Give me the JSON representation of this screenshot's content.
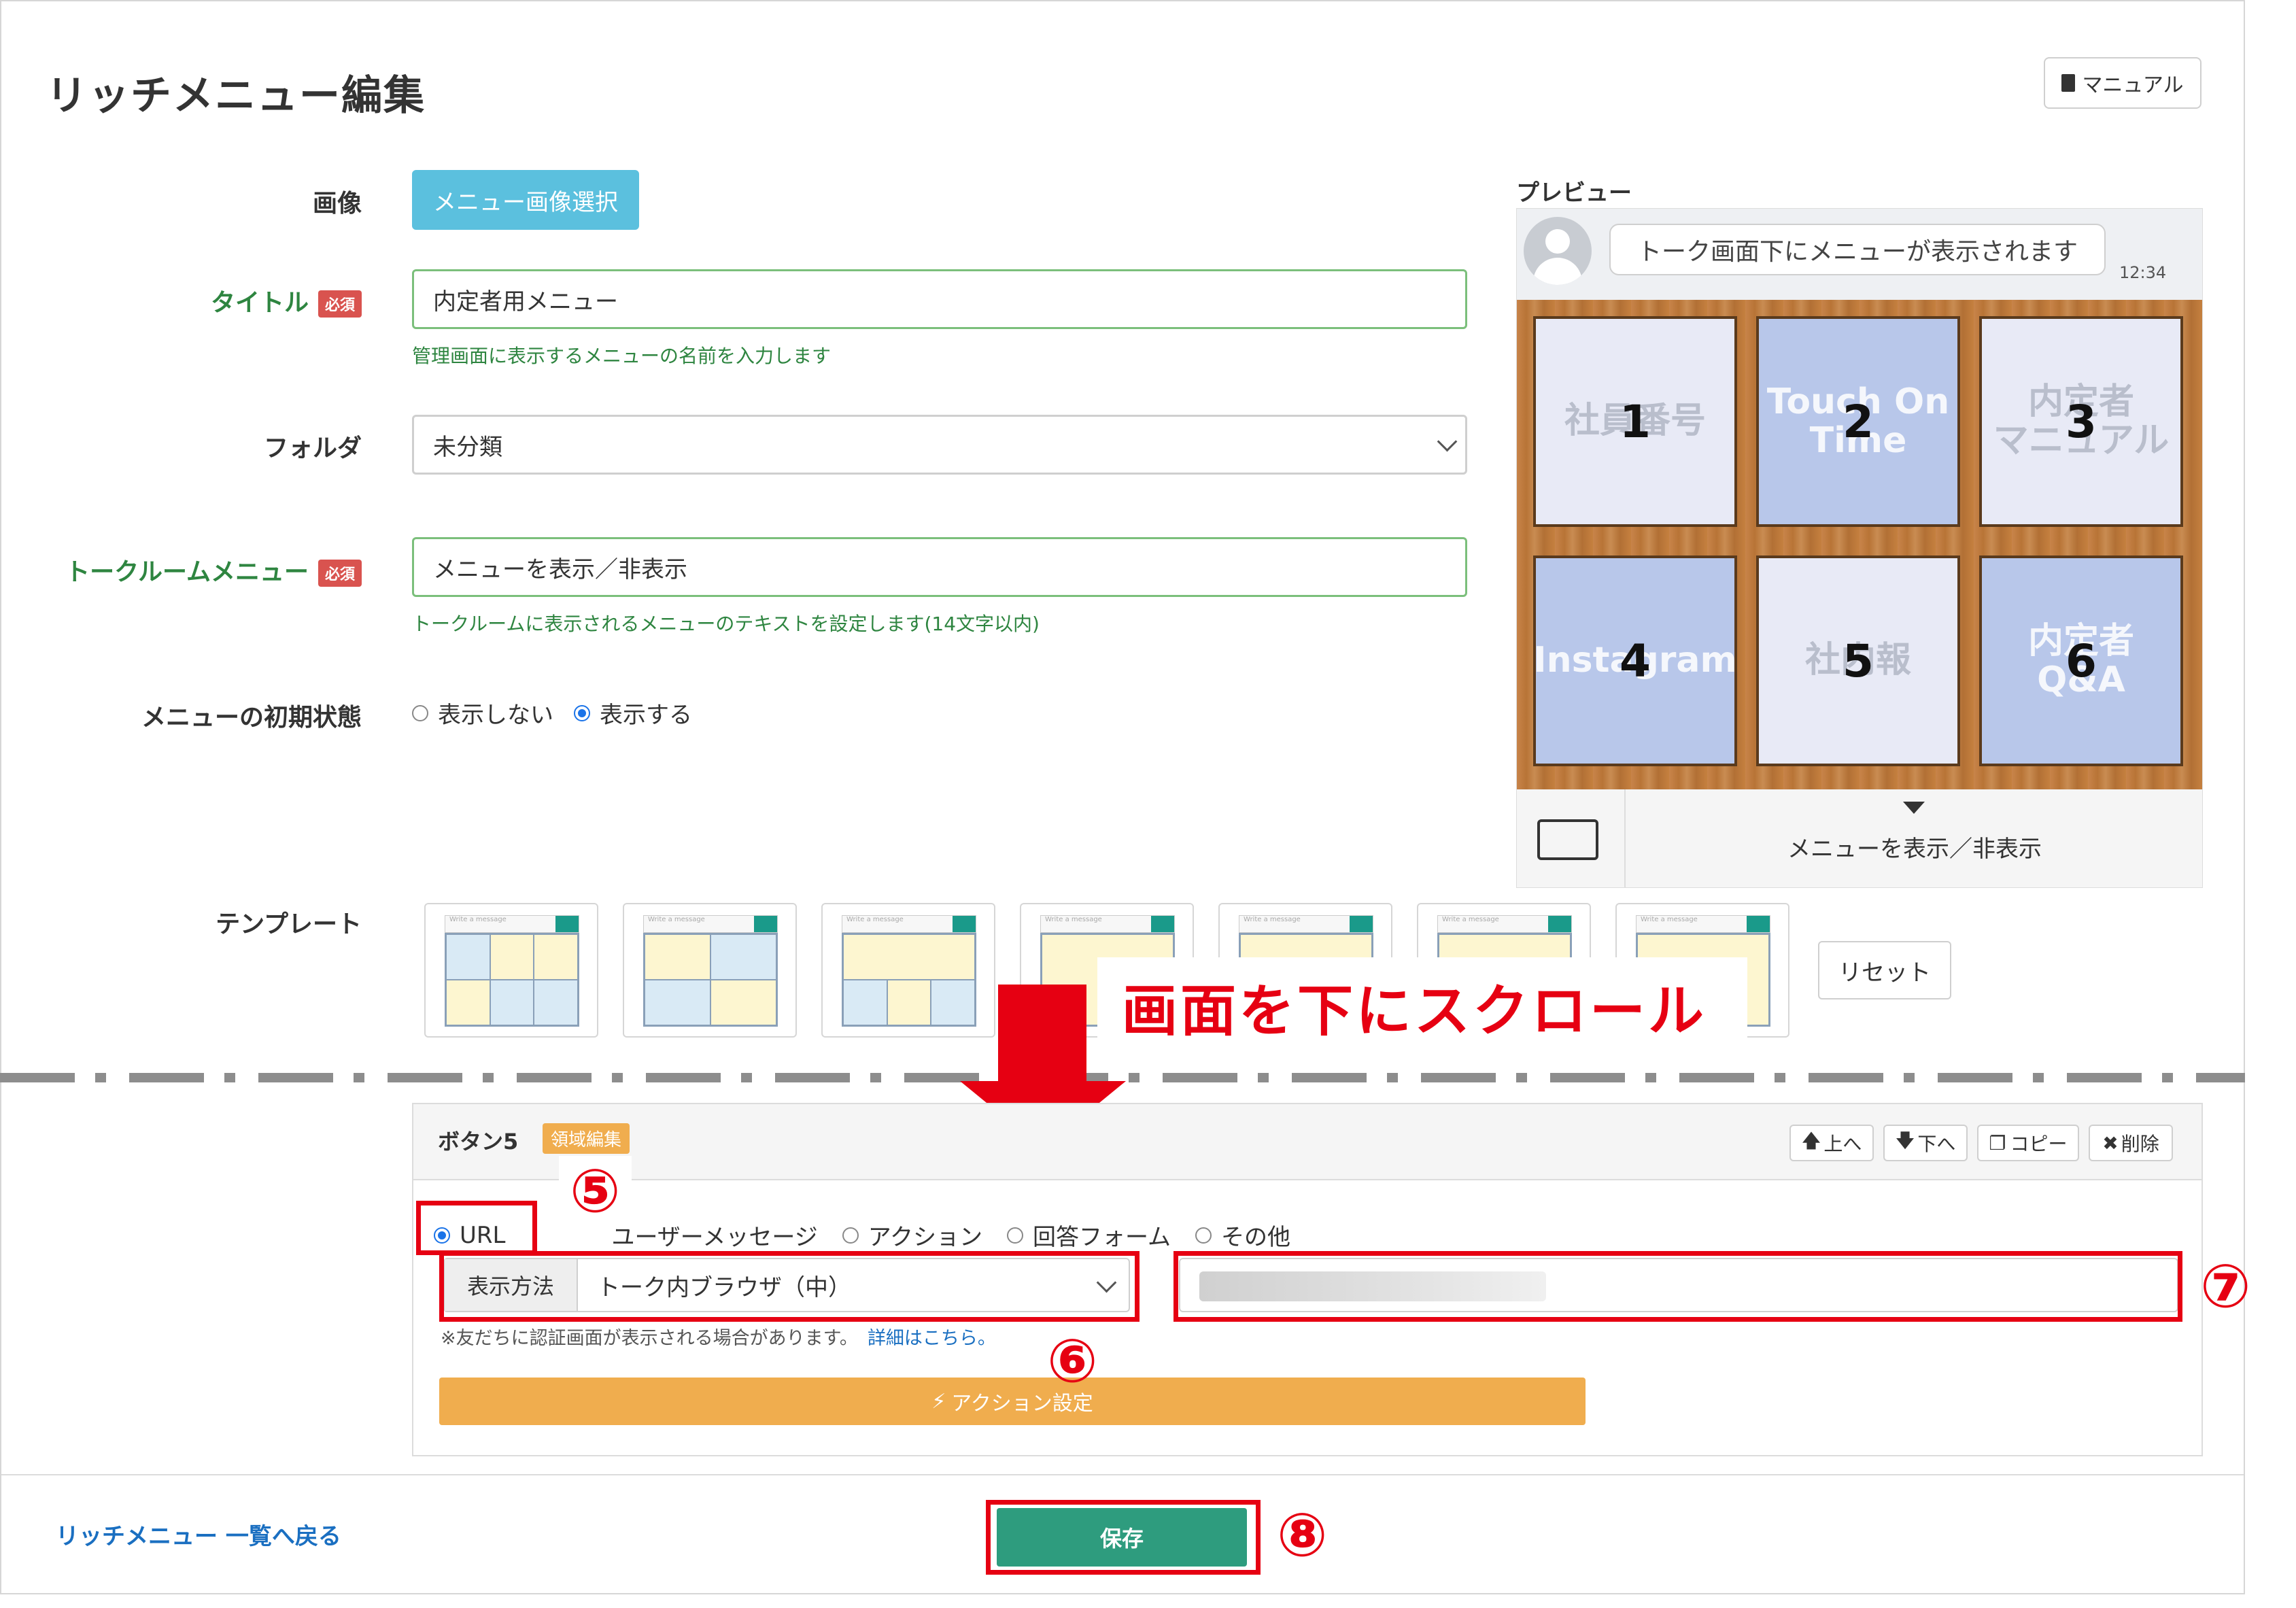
{
  "page": {
    "title": "リッチメニュー編集",
    "manual_label": "マニュアル"
  },
  "form": {
    "image_label": "画像",
    "image_button": "メニュー画像選択",
    "title_label": "タイトル",
    "required_badge": "必須",
    "title_value": "内定者用メニュー",
    "title_help": "管理画面に表示するメニューの名前を入力します",
    "folder_label": "フォルダ",
    "folder_value": "未分類",
    "talkroom_label": "トークルームメニュー",
    "talkroom_value": "メニューを表示／非表示",
    "talkroom_help": "トークルームに表示されるメニューのテキストを設定します(14文字以内)",
    "initial_state_label": "メニューの初期状態",
    "initial_options": [
      "表示しない",
      "表示する"
    ],
    "initial_selected": "表示する",
    "template_label": "テンプレート",
    "template_bar_text": "Write a message",
    "reset_label": "リセット"
  },
  "preview": {
    "label": "プレビュー",
    "bubble_text": "トーク画面下にメニューが表示されます",
    "time": "12:34",
    "tiles": [
      {
        "num": "1",
        "text": "社員番号",
        "style": "white"
      },
      {
        "num": "2",
        "text": "Touch On Time",
        "style": "blue"
      },
      {
        "num": "3",
        "text": "内定者\nマニュアル",
        "style": "white"
      },
      {
        "num": "4",
        "text": "Instagram",
        "style": "blue"
      },
      {
        "num": "5",
        "text": "社内報",
        "style": "white"
      },
      {
        "num": "6",
        "text": "内定者\nQ&A",
        "style": "blue"
      }
    ],
    "menu_label": "メニューを表示／非表示"
  },
  "annotation": {
    "scroll_text": "画面を下にスクロール",
    "step5": "⑤",
    "step6": "⑥",
    "step7": "⑦",
    "step8": "⑧"
  },
  "button_panel": {
    "title": "ボタン5",
    "area_edit": "領域編集",
    "up": "上へ",
    "down": "下へ",
    "copy": "コピー",
    "delete": "削除",
    "type_options": [
      "URL",
      "ユーザーメッセージ",
      "アクション",
      "回答フォーム",
      "その他"
    ],
    "type_selected": "URL",
    "display_method_label": "表示方法",
    "display_method_value": "トーク内ブラウザ（中）",
    "note": "※友だちに認証画面が表示される場合があります。",
    "note_link": "詳細はこちら。",
    "action_button": "アクション設定"
  },
  "footer": {
    "back_link": "リッチメニュー 一覧へ戻る",
    "save": "保存"
  },
  "colors": {
    "accent_red": "#e60012",
    "save_green": "#2e9c7e",
    "action_orange": "#f0ad4e",
    "image_btn_blue": "#5bc0de"
  }
}
